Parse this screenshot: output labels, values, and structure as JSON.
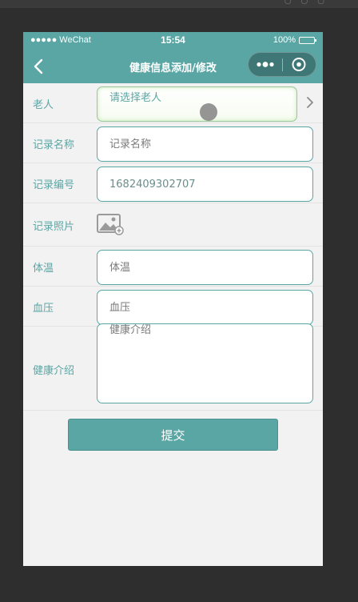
{
  "status_bar": {
    "carrier": "●●●●● WeChat",
    "time": "15:54",
    "battery": "100%"
  },
  "nav": {
    "title": "健康信息添加/修改"
  },
  "form": {
    "elder": {
      "label": "老人",
      "placeholder": "请选择老人"
    },
    "record_name": {
      "label": "记录名称",
      "placeholder": "记录名称",
      "value": ""
    },
    "record_number": {
      "label": "记录编号",
      "value": "1682409302707"
    },
    "record_photo": {
      "label": "记录照片"
    },
    "temperature": {
      "label": "体温",
      "placeholder": "体温",
      "value": ""
    },
    "blood_pressure": {
      "label": "血压",
      "placeholder": "血压",
      "value": ""
    },
    "health_intro": {
      "label": "健康介绍",
      "placeholder": "健康介绍",
      "value": ""
    }
  },
  "submit_label": "提交",
  "icons": {
    "back": "chevron-left-icon",
    "more": "more-dots-icon",
    "close": "target-circle-icon",
    "picker_arrow": "chevron-right-icon",
    "photo": "image-add-icon"
  },
  "colors": {
    "accent": "#5aa6a4",
    "page_bg": "#f2f2f2",
    "outer_bg": "#2e2e2e"
  }
}
